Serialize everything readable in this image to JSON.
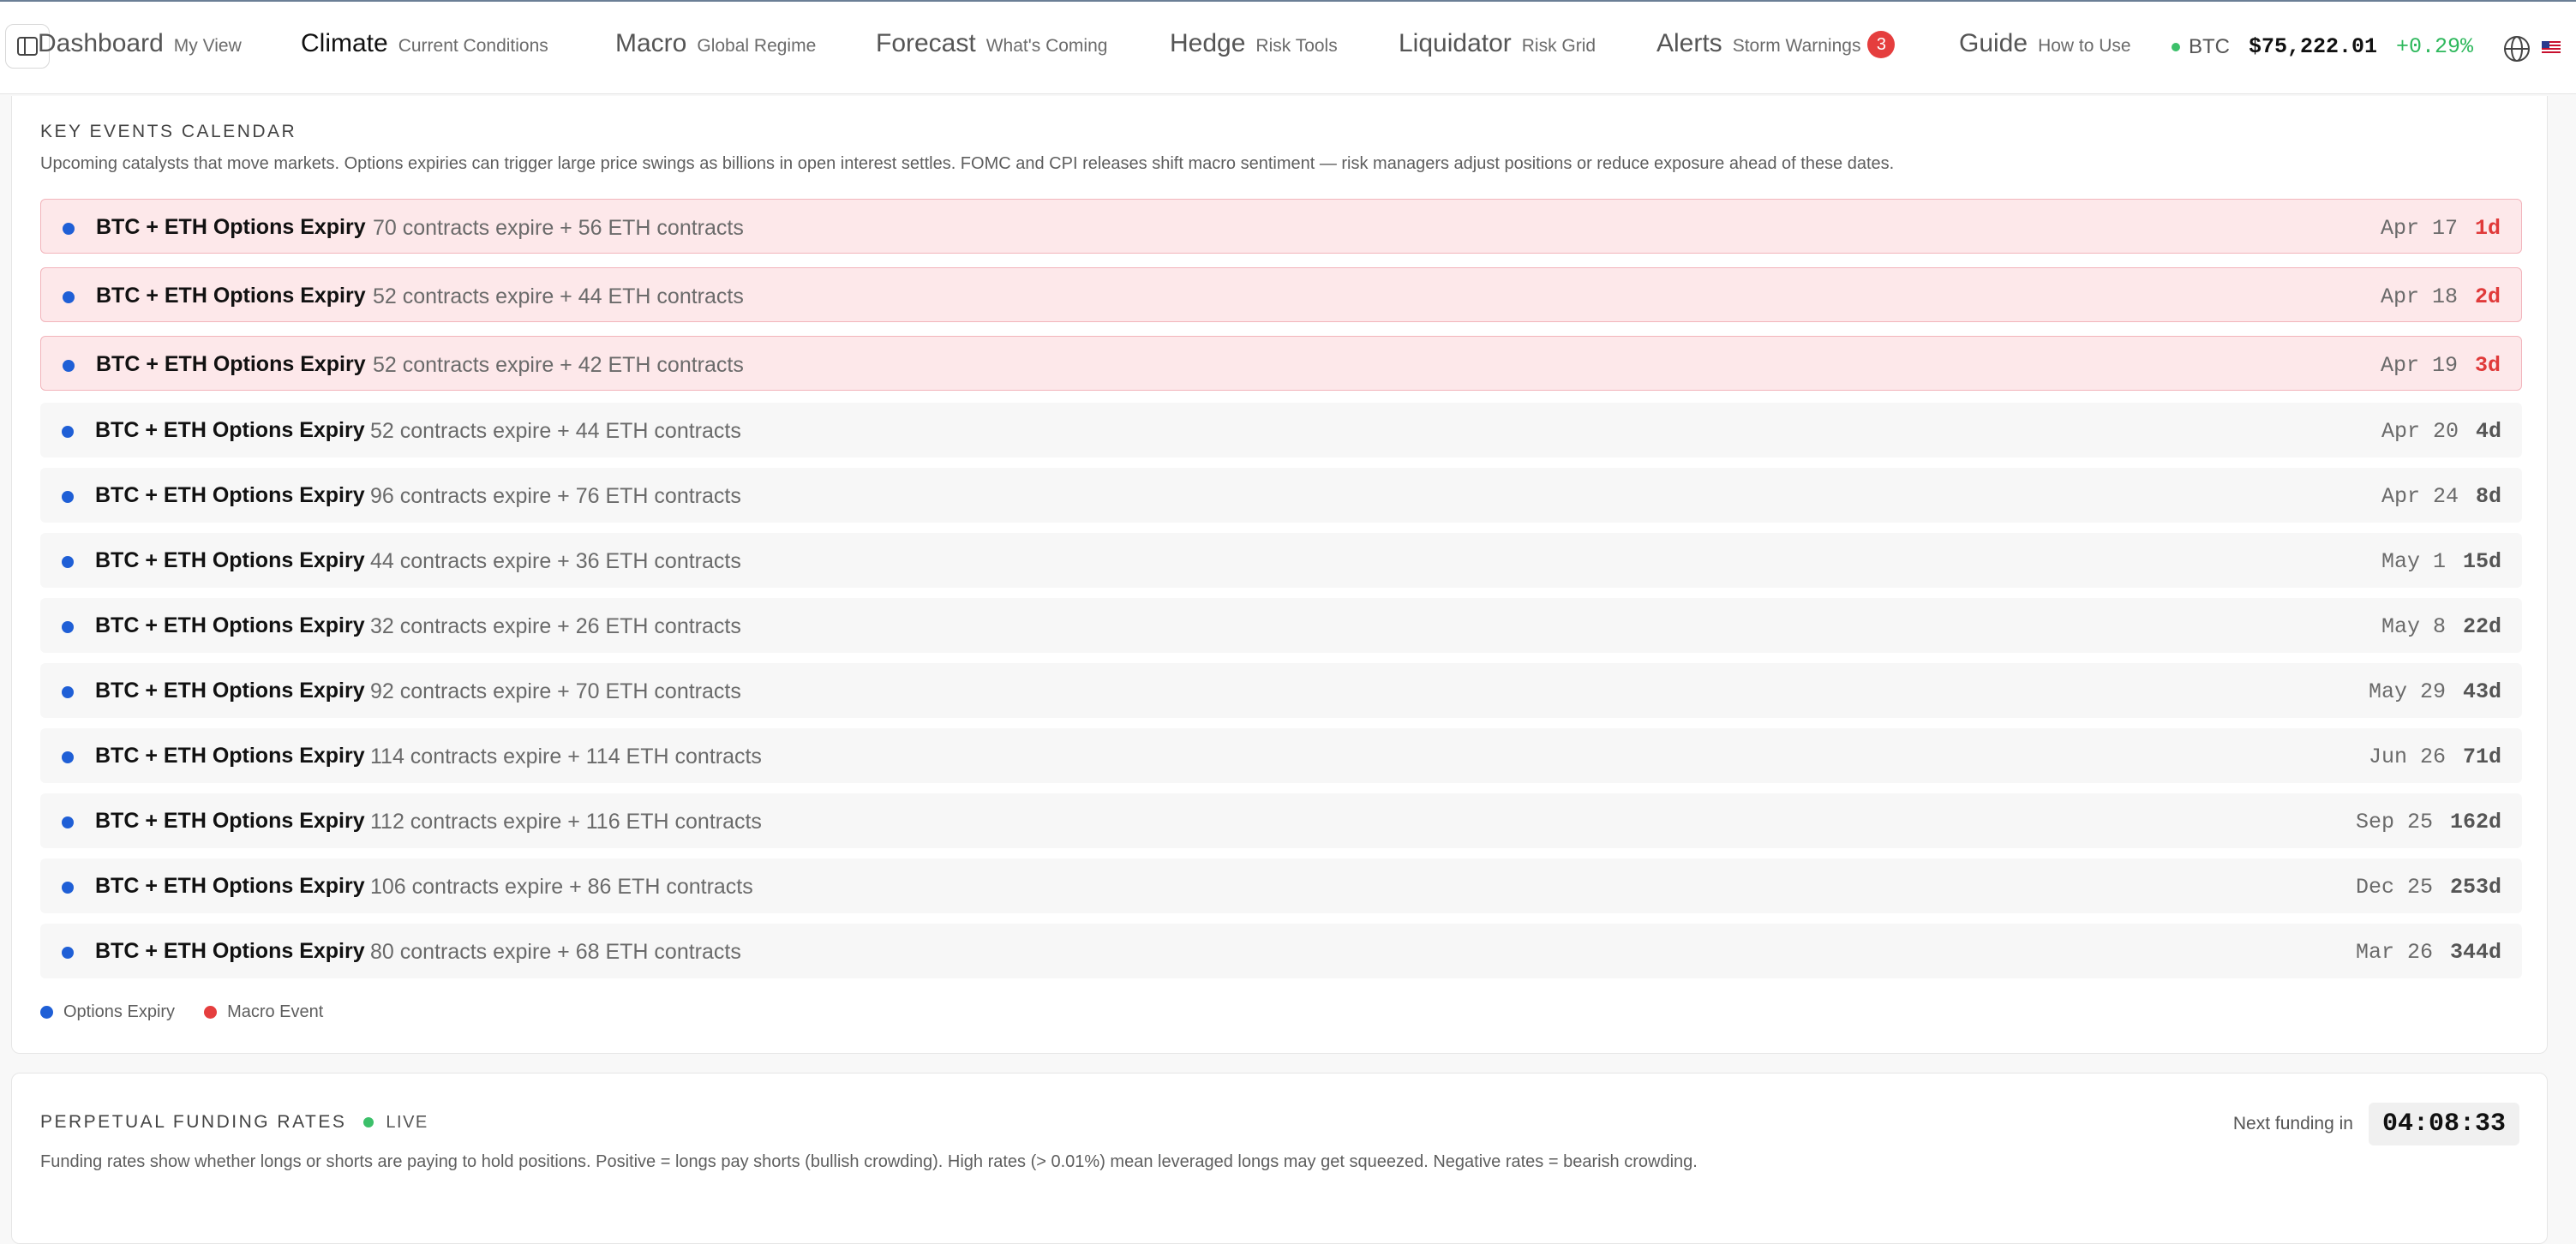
{
  "nav": {
    "items": [
      {
        "label": "Dashboard",
        "sub": "My View"
      },
      {
        "label": "Climate",
        "sub": "Current Conditions"
      },
      {
        "label": "Macro",
        "sub": "Global Regime"
      },
      {
        "label": "Forecast",
        "sub": "What's Coming"
      },
      {
        "label": "Hedge",
        "sub": "Risk Tools"
      },
      {
        "label": "Liquidator",
        "sub": "Risk Grid"
      },
      {
        "label": "Alerts",
        "sub": "Storm Warnings",
        "badge": "3"
      },
      {
        "label": "Guide",
        "sub": "How to Use"
      }
    ],
    "active": "Climate",
    "ticker": {
      "symbol": "BTC",
      "price": "$75,222.01",
      "change": "+0.29%"
    }
  },
  "calendar": {
    "title": "KEY EVENTS CALENDAR",
    "description": "Upcoming catalysts that move markets. Options expiries can trigger large price swings as billions in open interest settles. FOMC and CPI releases shift macro sentiment — risk managers adjust positions or reduce exposure ahead of these dates.",
    "events": [
      {
        "title": "BTC + ETH Options Expiry",
        "desc": "70 contracts expire + 56 ETH contracts",
        "date": "Apr 17",
        "days": "1d",
        "urgent": true
      },
      {
        "title": "BTC + ETH Options Expiry",
        "desc": "52 contracts expire + 44 ETH contracts",
        "date": "Apr 18",
        "days": "2d",
        "urgent": true
      },
      {
        "title": "BTC + ETH Options Expiry",
        "desc": "52 contracts expire + 42 ETH contracts",
        "date": "Apr 19",
        "days": "3d",
        "urgent": true
      },
      {
        "title": "BTC + ETH Options Expiry",
        "desc": "52 contracts expire + 44 ETH contracts",
        "date": "Apr 20",
        "days": "4d",
        "urgent": false
      },
      {
        "title": "BTC + ETH Options Expiry",
        "desc": "96 contracts expire + 76 ETH contracts",
        "date": "Apr 24",
        "days": "8d",
        "urgent": false
      },
      {
        "title": "BTC + ETH Options Expiry",
        "desc": "44 contracts expire + 36 ETH contracts",
        "date": "May 1",
        "days": "15d",
        "urgent": false
      },
      {
        "title": "BTC + ETH Options Expiry",
        "desc": "32 contracts expire + 26 ETH contracts",
        "date": "May 8",
        "days": "22d",
        "urgent": false
      },
      {
        "title": "BTC + ETH Options Expiry",
        "desc": "92 contracts expire + 70 ETH contracts",
        "date": "May 29",
        "days": "43d",
        "urgent": false
      },
      {
        "title": "BTC + ETH Options Expiry",
        "desc": "114 contracts expire + 114 ETH contracts",
        "date": "Jun 26",
        "days": "71d",
        "urgent": false
      },
      {
        "title": "BTC + ETH Options Expiry",
        "desc": "112 contracts expire + 116 ETH contracts",
        "date": "Sep 25",
        "days": "162d",
        "urgent": false
      },
      {
        "title": "BTC + ETH Options Expiry",
        "desc": "106 contracts expire + 86 ETH contracts",
        "date": "Dec 25",
        "days": "253d",
        "urgent": false
      },
      {
        "title": "BTC + ETH Options Expiry",
        "desc": "80 contracts expire + 68 ETH contracts",
        "date": "Mar 26",
        "days": "344d",
        "urgent": false
      }
    ],
    "legend": [
      {
        "label": "Options Expiry",
        "color": "#1f5fd6"
      },
      {
        "label": "Macro Event",
        "color": "#e53e3e"
      }
    ]
  },
  "funding": {
    "title": "PERPETUAL FUNDING RATES",
    "live_label": "LIVE",
    "next_label": "Next funding in",
    "countdown": "04:08:33",
    "description": "Funding rates show whether longs or shorts are paying to hold positions. Positive = longs pay shorts (bullish crowding). High rates (> 0.01%) mean leveraged longs may get squeezed. Negative rates = bearish crowding."
  },
  "colors": {
    "accent_blue": "#1f5fd6",
    "alert_red": "#e53e3e",
    "positive_green": "#2eb85c",
    "urgent_row_bg": "#fde8ea"
  },
  "icons": [
    "sidebar-toggle-icon",
    "globe-icon",
    "us-flag-icon"
  ]
}
